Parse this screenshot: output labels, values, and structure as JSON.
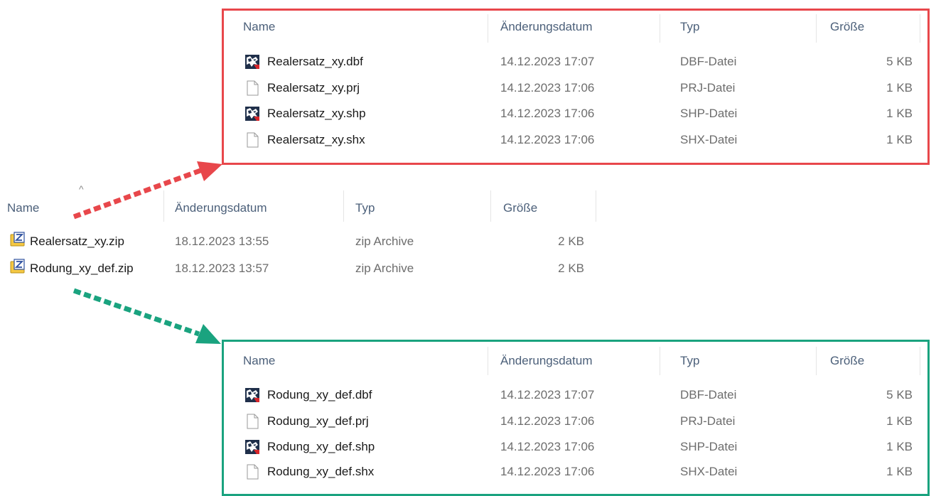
{
  "zip_panel": {
    "columns": {
      "name": "Name",
      "date": "Änderungsdatum",
      "type": "Typ",
      "size": "Größe"
    },
    "sort_caret": "^",
    "rows": [
      {
        "name": "Realersatz_xy.zip",
        "date": "18.12.2023 13:55",
        "type": "zip Archive",
        "size": "2 KB",
        "icon": "zip-archive-icon"
      },
      {
        "name": "Rodung_xy_def.zip",
        "date": "18.12.2023 13:57",
        "type": "zip Archive",
        "size": "2 KB",
        "icon": "zip-archive-icon"
      }
    ]
  },
  "realersatz_panel": {
    "border_color": "#e8474b",
    "columns": {
      "name": "Name",
      "date": "Änderungsdatum",
      "type": "Typ",
      "size": "Größe"
    },
    "rows": [
      {
        "name": "Realersatz_xy.dbf",
        "date": "14.12.2023 17:07",
        "type": "DBF-Datei",
        "size": "5 KB",
        "icon": "shapefile-icon"
      },
      {
        "name": "Realersatz_xy.prj",
        "date": "14.12.2023 17:06",
        "type": "PRJ-Datei",
        "size": "1 KB",
        "icon": "blank-file-icon"
      },
      {
        "name": "Realersatz_xy.shp",
        "date": "14.12.2023 17:06",
        "type": "SHP-Datei",
        "size": "1 KB",
        "icon": "shapefile-icon"
      },
      {
        "name": "Realersatz_xy.shx",
        "date": "14.12.2023 17:06",
        "type": "SHX-Datei",
        "size": "1 KB",
        "icon": "blank-file-icon"
      }
    ]
  },
  "rodung_panel": {
    "border_color": "#1aa37f",
    "columns": {
      "name": "Name",
      "date": "Änderungsdatum",
      "type": "Typ",
      "size": "Größe"
    },
    "rows": [
      {
        "name": "Rodung_xy_def.dbf",
        "date": "14.12.2023 17:07",
        "type": "DBF-Datei",
        "size": "5 KB",
        "icon": "shapefile-icon"
      },
      {
        "name": "Rodung_xy_def.prj",
        "date": "14.12.2023 17:06",
        "type": "PRJ-Datei",
        "size": "1 KB",
        "icon": "blank-file-icon"
      },
      {
        "name": "Rodung_xy_def.shp",
        "date": "14.12.2023 17:06",
        "type": "SHP-Datei",
        "size": "1 KB",
        "icon": "shapefile-icon"
      },
      {
        "name": "Rodung_xy_def.shx",
        "date": "14.12.2023 17:06",
        "type": "SHX-Datei",
        "size": "1 KB",
        "icon": "blank-file-icon"
      }
    ]
  },
  "arrows": {
    "red_color": "#e8474b",
    "green_color": "#1aa37f"
  }
}
